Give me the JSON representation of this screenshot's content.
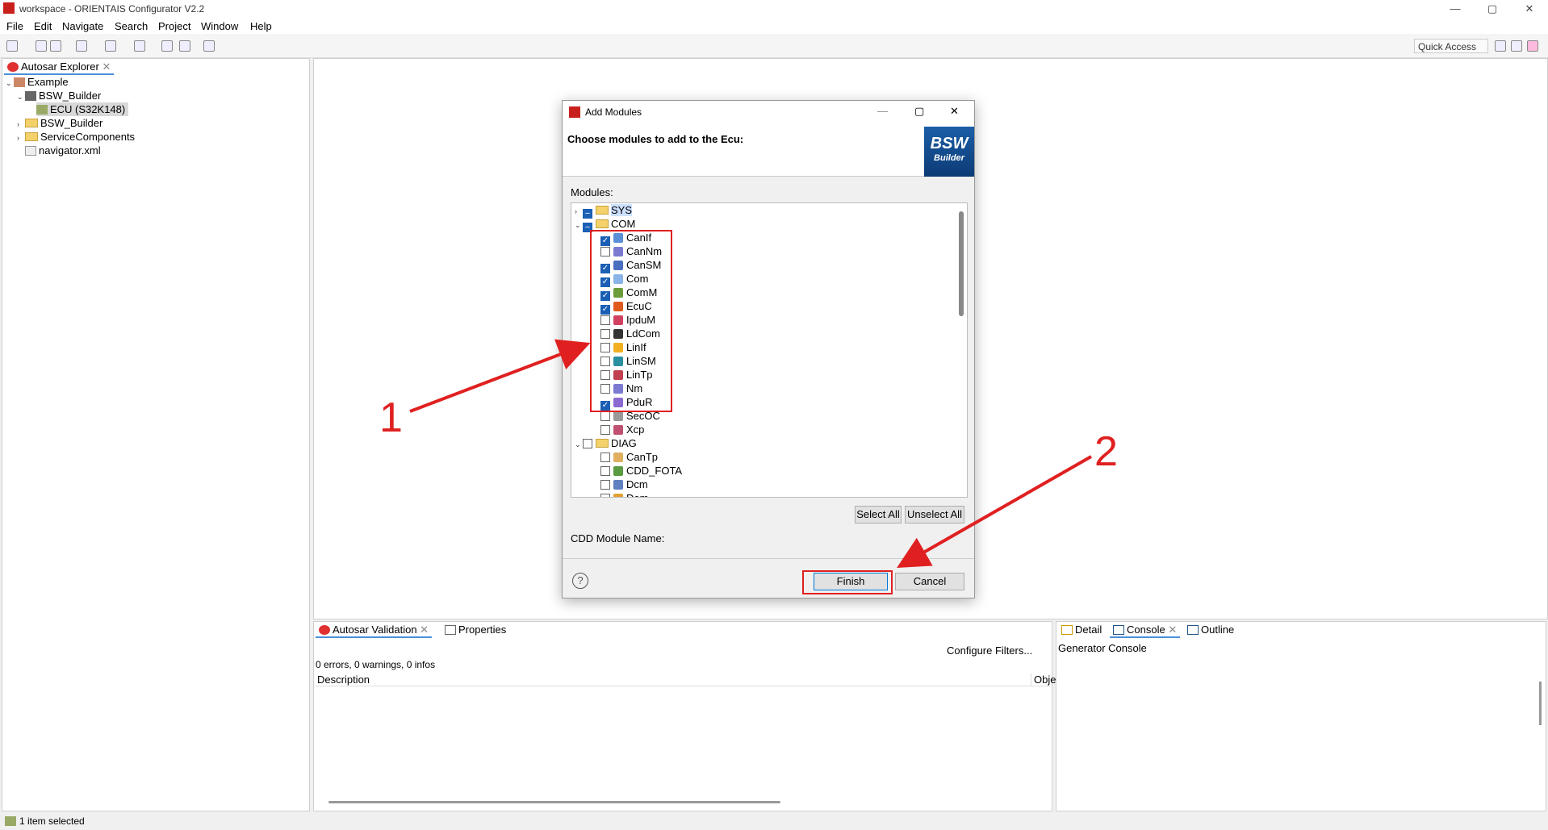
{
  "window": {
    "title": "workspace - ORIENTAIS Configurator V2.2",
    "controls": {
      "minimize": "—",
      "maximize": "▢",
      "close": "✕"
    }
  },
  "menu": [
    "File",
    "Edit",
    "Navigate",
    "Search",
    "Project",
    "Window",
    "Help"
  ],
  "toolbar": {
    "quick_access": "Quick Access"
  },
  "explorer": {
    "tab": "Autosar Explorer",
    "tree": [
      {
        "label": "Example",
        "level": 0,
        "expanded": true
      },
      {
        "label": "BSW_Builder",
        "level": 1,
        "expanded": true
      },
      {
        "label": "ECU (S32K148)",
        "level": 2,
        "selected": true
      },
      {
        "label": "BSW_Builder",
        "level": 1,
        "expanded": false
      },
      {
        "label": "ServiceComponents",
        "level": 1,
        "expanded": false
      },
      {
        "label": "navigator.xml",
        "level": 1
      }
    ]
  },
  "dialog": {
    "title": "Add Modules",
    "heading": "Choose modules to add to the Ecu:",
    "logo": {
      "line1": "BSW",
      "line2": "Builder"
    },
    "modules_label": "Modules:",
    "groups": [
      {
        "name": "SYS",
        "expanded": false,
        "state": "partial"
      },
      {
        "name": "COM",
        "expanded": true,
        "state": "partial"
      },
      {
        "name": "DIAG",
        "expanded": true,
        "state": "unchecked"
      }
    ],
    "com_modules": [
      {
        "name": "CanIf",
        "checked": true,
        "color": "#5b8fd6"
      },
      {
        "name": "CanNm",
        "checked": false,
        "color": "#7a7ad0"
      },
      {
        "name": "CanSM",
        "checked": true,
        "color": "#4b6fbf"
      },
      {
        "name": "Com",
        "checked": true,
        "color": "#8ab4e8"
      },
      {
        "name": "ComM",
        "checked": true,
        "color": "#6b9c3a"
      },
      {
        "name": "EcuC",
        "checked": true,
        "color": "#e05a1e"
      },
      {
        "name": "IpduM",
        "checked": false,
        "color": "#d04060"
      },
      {
        "name": "LdCom",
        "checked": false,
        "color": "#333333"
      },
      {
        "name": "LinIf",
        "checked": false,
        "color": "#f0b020"
      },
      {
        "name": "LinSM",
        "checked": false,
        "color": "#2a8fa0"
      },
      {
        "name": "LinTp",
        "checked": false,
        "color": "#c04050"
      },
      {
        "name": "Nm",
        "checked": false,
        "color": "#7a7ad0"
      },
      {
        "name": "PduR",
        "checked": true,
        "color": "#8a6ad0"
      },
      {
        "name": "SecOC",
        "checked": false,
        "color": "#999999"
      },
      {
        "name": "Xcp",
        "checked": false,
        "color": "#c05070"
      }
    ],
    "diag_modules": [
      {
        "name": "CanTp",
        "checked": false,
        "color": "#e0b060"
      },
      {
        "name": "CDD_FOTA",
        "checked": false,
        "color": "#5a9a40"
      },
      {
        "name": "Dcm",
        "checked": false,
        "color": "#6080c0"
      },
      {
        "name": "Dem",
        "checked": false,
        "color": "#e0a030"
      }
    ],
    "select_all": "Select All",
    "unselect_all": "Unselect All",
    "cdd_label": "CDD Module Name:",
    "help": "?",
    "finish": "Finish",
    "cancel": "Cancel"
  },
  "validation": {
    "tabs": [
      "Autosar Validation",
      "Properties"
    ],
    "configure": "Configure Filters...",
    "summary": "0 errors, 0 warnings, 0 infos",
    "columns": [
      "Description",
      "Obje"
    ]
  },
  "detail": {
    "tabs": [
      "Detail",
      "Console",
      "Outline"
    ],
    "console_title": "Generator Console"
  },
  "status": {
    "text": "1 item selected"
  },
  "annotations": {
    "one": "1",
    "two": "2"
  }
}
